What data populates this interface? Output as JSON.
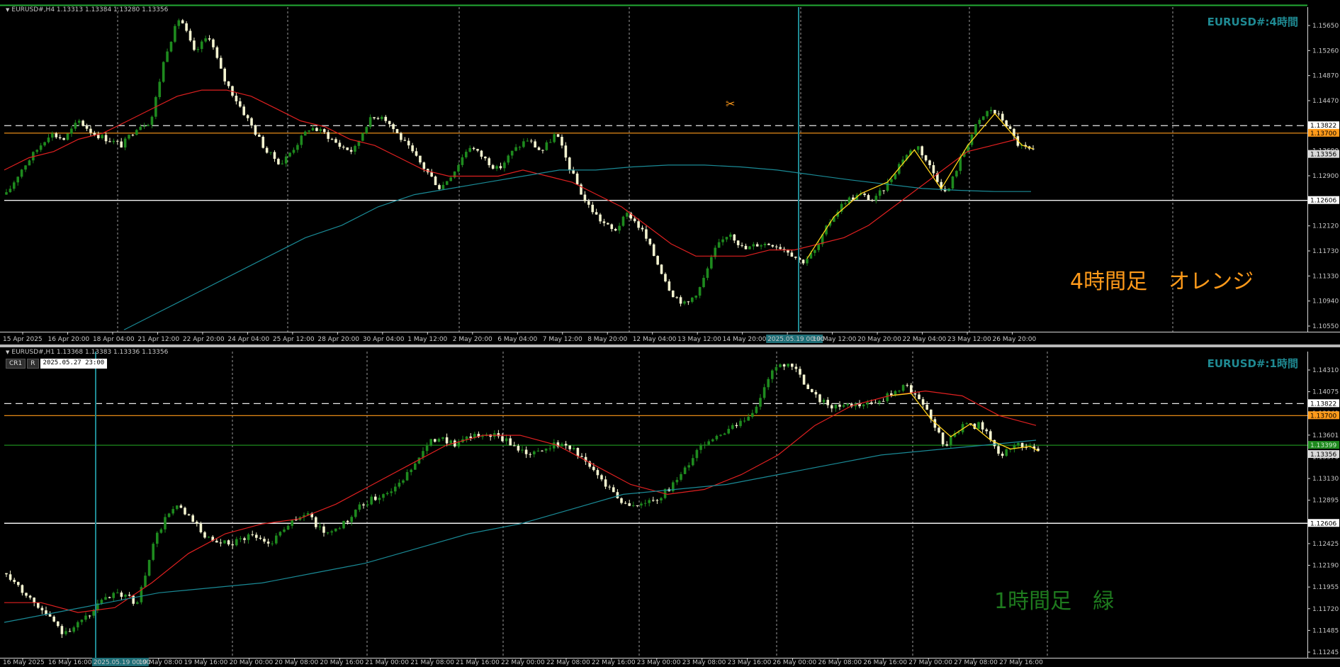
{
  "panels": [
    {
      "header": "EURUSD#,H4  1.13313 1.13384 1.13280 1.13356",
      "symbol_label": "EURUSD#:4時間",
      "note": "4時間足　オレンジ",
      "note_color": "#ff9a1a",
      "price_ticks": [
        "1.15650",
        "1.15260",
        "1.14870",
        "1.14470",
        "1.14080",
        "1.13690",
        "1.12900",
        "1.12510",
        "1.12120",
        "1.11730",
        "1.11330",
        "1.10940",
        "1.10550"
      ],
      "time_ticks": [
        "15 Apr 2025",
        "16 Apr 20:00",
        "18 Apr 04:00",
        "21 Apr 12:00",
        "22 Apr 20:00",
        "24 Apr 04:00",
        "25 Apr 12:00",
        "28 Apr 20:00",
        "30 Apr 04:00",
        "1 May 12:00",
        "2 May 20:00",
        "6 May 04:00",
        "7 May 12:00",
        "8 May 20:00",
        "12 May 04:00",
        "13 May 12:00",
        "14 May 20:00",
        "2025.05.19 00:00",
        "19 May 12:00",
        "20 May 20:00",
        "22 May 04:00",
        "23 May 12:00",
        "26 May 20:00"
      ],
      "level_labels": {
        "dashed": "1.13822",
        "orange": "1.13700",
        "current": "1.13356",
        "white": "1.12606"
      }
    },
    {
      "header": "EURUSD#,H1  1.13368 1.13383 1.13336 1.13356",
      "symbol_label": "EURUSD#:1時間",
      "note": "1時間足　緑",
      "note_color": "#1e7a1e",
      "price_ticks": [
        "1.14310",
        "1.14075",
        "1.13840",
        "1.13601",
        "1.13370",
        "1.13130",
        "1.12895",
        "1.12660",
        "1.12425",
        "1.12190",
        "1.11955",
        "1.11720",
        "1.11485",
        "1.11245"
      ],
      "time_ticks": [
        "16 May 2025",
        "16 May 16:00",
        "2025.05.19 00:00",
        "19 May 08:00",
        "19 May 16:00",
        "20 May 00:00",
        "20 May 08:00",
        "20 May 16:00",
        "21 May 00:00",
        "21 May 08:00",
        "21 May 16:00",
        "22 May 00:00",
        "22 May 08:00",
        "22 May 16:00",
        "23 May 00:00",
        "23 May 08:00",
        "23 May 16:00",
        "26 May 00:00",
        "26 May 08:00",
        "26 May 16:00",
        "27 May 00:00",
        "27 May 08:00",
        "27 May 16:00"
      ],
      "level_labels": {
        "dashed": "1.13822",
        "orange": "1.13700",
        "green": "1.13399",
        "current": "1.13356",
        "white": "1.12606"
      },
      "cr_button": "CR1",
      "r_button": "R",
      "datetime": "2025.05.27  23:00"
    }
  ],
  "chart_data": [
    {
      "type": "candlestick",
      "title": "EURUSD#,H4",
      "ylim": [
        1.1047,
        1.1575
      ],
      "levels": {
        "dashed": 1.13822,
        "orange": 1.137,
        "white": 1.12606
      },
      "ohlc_anchors": [
        1.127,
        1.131,
        1.134,
        1.137,
        1.136,
        1.139,
        1.137,
        1.136,
        1.135,
        1.138,
        1.139,
        1.15,
        1.156,
        1.15,
        1.153,
        1.146,
        1.142,
        1.138,
        1.134,
        1.132,
        1.135,
        1.138,
        1.137,
        1.135,
        1.134,
        1.139,
        1.14,
        1.137,
        1.134,
        1.131,
        1.128,
        1.131,
        1.135,
        1.133,
        1.131,
        1.134,
        1.136,
        1.134,
        1.137,
        1.131,
        1.126,
        1.123,
        1.121,
        1.124,
        1.121,
        1.116,
        1.111,
        1.109,
        1.112,
        1.118,
        1.121,
        1.118,
        1.119,
        1.119,
        1.118,
        1.116,
        1.118,
        1.123,
        1.126,
        1.127,
        1.126,
        1.129,
        1.133,
        1.135,
        1.131,
        1.127,
        1.133,
        1.138,
        1.141,
        1.139,
        1.135,
        1.134
      ],
      "series": [
        {
          "name": "",
          "color": "#e02020",
          "values": [
            1.131,
            1.133,
            1.134,
            1.136,
            1.137,
            1.139,
            1.141,
            1.143,
            1.144,
            1.144,
            1.143,
            1.141,
            1.139,
            1.138,
            1.136,
            1.135,
            1.133,
            1.131,
            1.13,
            1.13,
            1.13,
            1.131,
            1.13,
            1.129,
            1.127,
            1.125,
            1.122,
            1.119,
            1.117,
            1.117,
            1.117,
            1.118,
            1.118,
            1.119,
            1.12,
            1.122,
            1.125,
            1.128,
            1.131,
            1.134,
            1.135,
            1.136
          ]
        },
        {
          "name": "",
          "color": "#1a8a96",
          "values": [
            1.105,
            1.108,
            1.111,
            1.114,
            1.117,
            1.12,
            1.122,
            1.125,
            1.127,
            1.128,
            1.129,
            1.13,
            1.131,
            1.131,
            1.1315,
            1.1318,
            1.1318,
            1.1315,
            1.131,
            1.1302,
            1.1294,
            1.1287,
            1.128,
            1.1277,
            1.1275,
            1.1275
          ]
        }
      ]
    },
    {
      "type": "candlestick",
      "title": "EURUSD#,H1",
      "ylim": [
        1.1124,
        1.1435
      ],
      "levels": {
        "dashed": 1.13822,
        "orange": 1.137,
        "green": 1.13399,
        "white": 1.12606
      },
      "ohlc_anchors": [
        1.121,
        1.119,
        1.117,
        1.115,
        1.116,
        1.118,
        1.119,
        1.118,
        1.125,
        1.128,
        1.126,
        1.124,
        1.124,
        1.125,
        1.124,
        1.126,
        1.127,
        1.125,
        1.126,
        1.128,
        1.129,
        1.13,
        1.133,
        1.135,
        1.134,
        1.135,
        1.135,
        1.134,
        1.133,
        1.134,
        1.134,
        1.132,
        1.13,
        1.128,
        1.128,
        1.129,
        1.131,
        1.134,
        1.135,
        1.136,
        1.138,
        1.142,
        1.142,
        1.139,
        1.138,
        1.138,
        1.138,
        1.139,
        1.14,
        1.138,
        1.134,
        1.136,
        1.136,
        1.133,
        1.134,
        1.1336
      ],
      "series": [
        {
          "name": "",
          "color": "#e02020",
          "values": [
            1.118,
            1.118,
            1.117,
            1.1175,
            1.12,
            1.123,
            1.125,
            1.126,
            1.1265,
            1.128,
            1.13,
            1.132,
            1.134,
            1.135,
            1.135,
            1.134,
            1.132,
            1.13,
            1.129,
            1.1295,
            1.131,
            1.133,
            1.136,
            1.138,
            1.139,
            1.1395,
            1.139,
            1.137,
            1.136
          ]
        },
        {
          "name": "",
          "color": "#1a8a96",
          "values": [
            1.116,
            1.117,
            1.118,
            1.119,
            1.1195,
            1.12,
            1.121,
            1.122,
            1.1235,
            1.125,
            1.126,
            1.1275,
            1.129,
            1.1295,
            1.13,
            1.131,
            1.132,
            1.133,
            1.1335,
            1.134,
            1.1345
          ]
        }
      ]
    }
  ]
}
